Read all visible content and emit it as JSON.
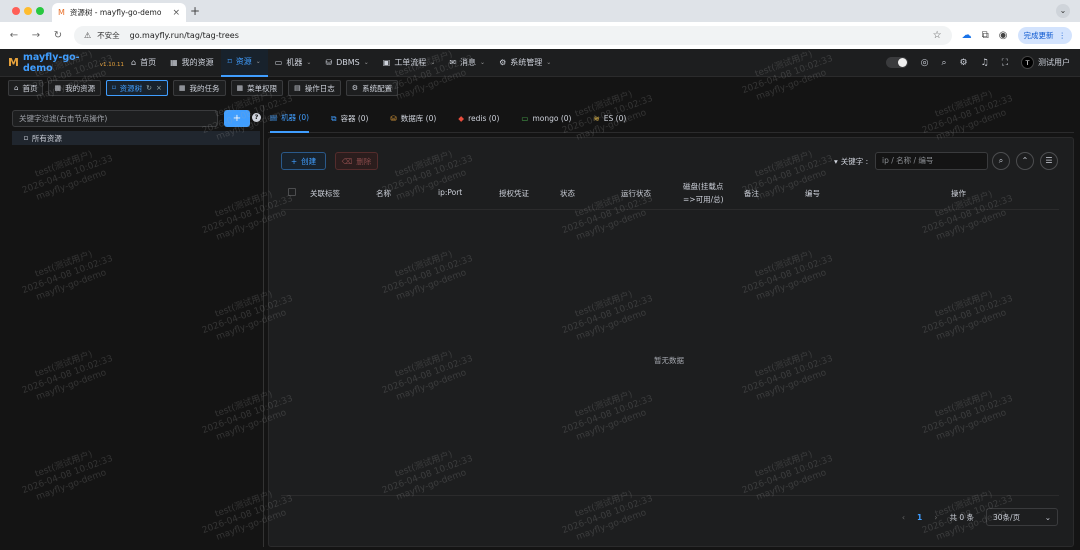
{
  "browser": {
    "tab_title": "资源树 - mayfly-go-demo",
    "insecure_label": "不安全",
    "url": "go.mayfly.run/tag/tag-trees",
    "update_label": "完成更新"
  },
  "app": {
    "logo_name": "mayfly-go-demo",
    "version": "v1.10.11"
  },
  "topnav": {
    "items": [
      {
        "label": "首页",
        "icon": "home-icon"
      },
      {
        "label": "我的资源",
        "icon": "grid-icon"
      },
      {
        "label": "资源",
        "icon": "bookmark-icon",
        "active": true,
        "dropdown": true
      },
      {
        "label": "机器",
        "icon": "monitor-icon",
        "dropdown": true
      },
      {
        "label": "DBMS",
        "icon": "database-icon",
        "dropdown": true
      },
      {
        "label": "工单流程",
        "icon": "briefcase-icon",
        "dropdown": true
      },
      {
        "label": "消息",
        "icon": "mail-icon",
        "dropdown": true
      },
      {
        "label": "系统管理",
        "icon": "gear-icon",
        "dropdown": true
      }
    ],
    "user_initial": "T",
    "user_name": "测试用户"
  },
  "tagsbar": {
    "items": [
      {
        "label": "首页",
        "icon": "home-icon"
      },
      {
        "label": "我的资源",
        "icon": "grid-icon"
      },
      {
        "label": "资源树",
        "icon": "bookmark-icon",
        "active": true
      },
      {
        "label": "我的任务",
        "icon": "grid-icon"
      },
      {
        "label": "菜单权限",
        "icon": "grid-icon"
      },
      {
        "label": "操作日志",
        "icon": "document-icon"
      },
      {
        "label": "系统配置",
        "icon": "gear-icon"
      }
    ]
  },
  "tree": {
    "search_placeholder": "关键字过滤(右击节点操作)",
    "add_label": "+",
    "help_label": "?",
    "root_node": "所有资源"
  },
  "resource_tabs": [
    {
      "label": "机器 (0)",
      "icon": "monitor-icon",
      "active": true
    },
    {
      "label": "容器 (0)",
      "icon": "container-icon"
    },
    {
      "label": "数据库 (0)",
      "icon": "database-icon"
    },
    {
      "label": "redis (0)",
      "icon": "redis-icon"
    },
    {
      "label": "mongo (0)",
      "icon": "mongo-icon"
    },
    {
      "label": "ES (0)",
      "icon": "es-icon"
    }
  ],
  "toolbar": {
    "create_label": "创建",
    "delete_label": "删除",
    "keyword_label": "关键字 :",
    "keyword_placeholder": "ip / 名称 / 编号"
  },
  "table": {
    "headers": [
      "关联标签",
      "名称",
      "ip:Port",
      "授权凭证",
      "状态",
      "运行状态",
      "磁盘(挂载点=>可用/总)",
      "备注",
      "编号",
      "操作"
    ],
    "empty_text": "暂无数据"
  },
  "pagination": {
    "current_page": "1",
    "total_label": "共 0 条",
    "page_size_label": "30条/页"
  },
  "watermark": {
    "line1": "test(测试用户)",
    "line2": "2026-04-08 10:02:33",
    "line3": "mayfly-go-demo"
  }
}
